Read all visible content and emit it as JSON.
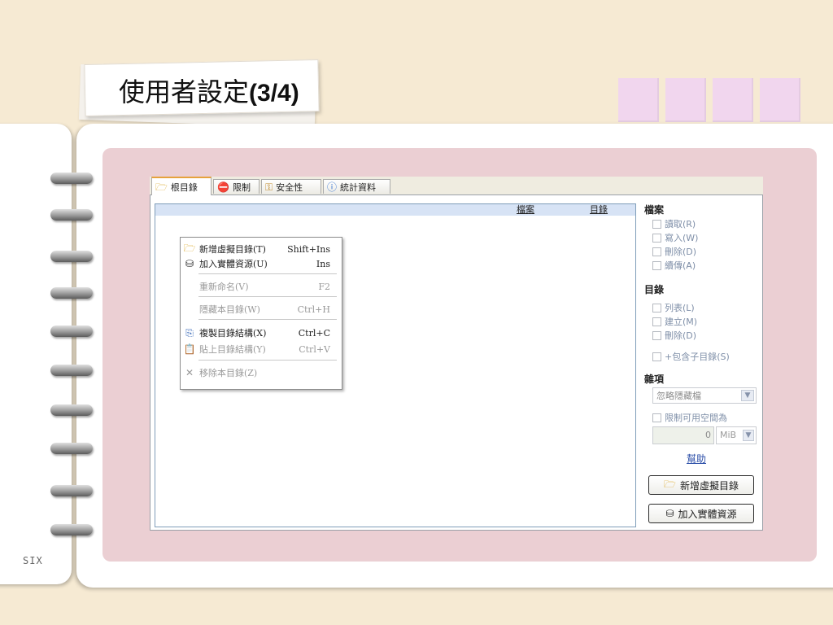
{
  "slide": {
    "title": "使用者設定",
    "title_suffix": "(3/4)",
    "page_label": "SIX"
  },
  "tabs": [
    {
      "label": "根目錄",
      "icon": "folder-icon"
    },
    {
      "label": "限制",
      "icon": "no-entry-icon"
    },
    {
      "label": "安全性",
      "icon": "key-icon"
    },
    {
      "label": "統計資料",
      "icon": "info-icon"
    }
  ],
  "tree": {
    "columns": [
      "檔案",
      "目錄"
    ]
  },
  "context_menu": {
    "items": [
      {
        "label": "新增虛擬目錄(T)",
        "shortcut": "Shift+Ins",
        "icon": "folder-icon",
        "enabled": true
      },
      {
        "label": "加入實體資源(U)",
        "shortcut": "Ins",
        "icon": "database-icon",
        "enabled": true
      },
      {
        "label": "重新命名(V)",
        "shortcut": "F2",
        "icon": "",
        "enabled": false
      },
      {
        "label": "隱藏本目錄(W)",
        "shortcut": "Ctrl+H",
        "icon": "",
        "enabled": false
      },
      {
        "label": "複製目錄結構(X)",
        "shortcut": "Ctrl+C",
        "icon": "copy-icon",
        "enabled": true
      },
      {
        "label": "貼上目錄結構(Y)",
        "shortcut": "Ctrl+V",
        "icon": "paste-icon",
        "enabled": false
      },
      {
        "label": "移除本目錄(Z)",
        "shortcut": "",
        "icon": "delete-icon",
        "enabled": false
      }
    ]
  },
  "side": {
    "files_heading": "檔案",
    "files_perms": [
      "讀取(R)",
      "寫入(W)",
      "刪除(D)",
      "續傳(A)"
    ],
    "dirs_heading": "目錄",
    "dirs_perms": [
      "列表(L)",
      "建立(M)",
      "刪除(D)"
    ],
    "include_subdirs": "+包含子目錄(S)",
    "misc_heading": "雜項",
    "hidden_select": "忽略隱藏檔",
    "limit_space": "限制可用空間為",
    "space_value": "0",
    "space_unit": "MiB",
    "help_link": "幫助",
    "add_virtual_button": "新增虛擬目錄",
    "add_physical_button": "加入實體資源"
  }
}
